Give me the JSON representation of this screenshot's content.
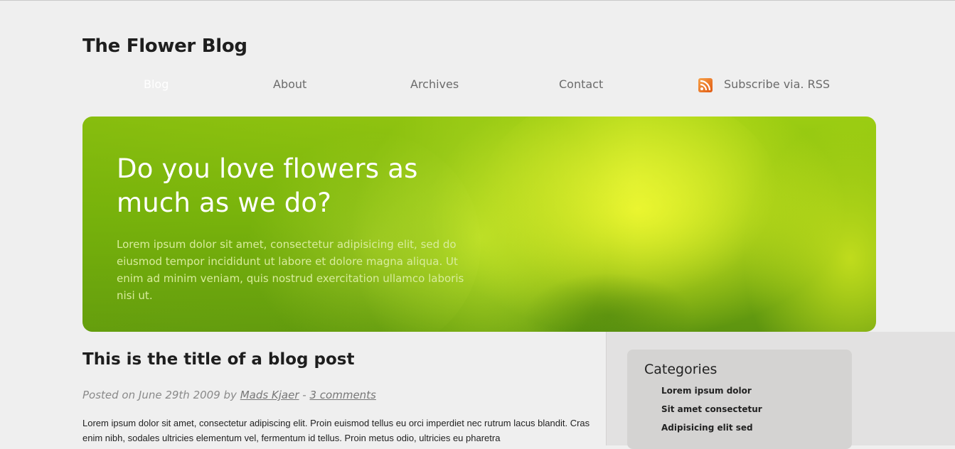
{
  "site": {
    "title": "The Flower Blog"
  },
  "nav": {
    "items": [
      {
        "label": "Blog",
        "active": true
      },
      {
        "label": "About",
        "active": false
      },
      {
        "label": "Archives",
        "active": false
      },
      {
        "label": "Contact",
        "active": false
      }
    ],
    "rss": {
      "label": "Subscribe via. RSS",
      "icon": "rss-icon"
    }
  },
  "hero": {
    "heading": "Do you love flowers as much as we do?",
    "text": "Lorem ipsum dolor sit amet, consectetur adipisicing elit, sed do eiusmod tempor incididunt ut labore et dolore magna aliqua. Ut enim ad minim veniam, quis nostrud exercitation ullamco laboris nisi ut."
  },
  "post": {
    "title": "This is the title of a blog post",
    "meta_prefix": "Posted on June 29th 2009 by ",
    "author": "Mads Kjaer",
    "meta_sep": " - ",
    "comments": "3 comments",
    "body": "Lorem ipsum dolor sit amet, consectetur adipiscing elit. Proin euismod tellus eu orci imperdiet nec rutrum lacus blandit. Cras enim nibh, sodales ultricies elementum vel, fermentum id tellus. Proin metus odio, ultricies eu pharetra"
  },
  "sidebar": {
    "categories_title": "Categories",
    "categories": [
      "Lorem ipsum dolor",
      "Sit amet consectetur",
      "Adipisicing elit sed"
    ]
  },
  "colors": {
    "background": "#efefef",
    "hero_green": "#8cc40f",
    "sidebar": "#e2e1e1",
    "category_box": "#d4d3d2"
  }
}
